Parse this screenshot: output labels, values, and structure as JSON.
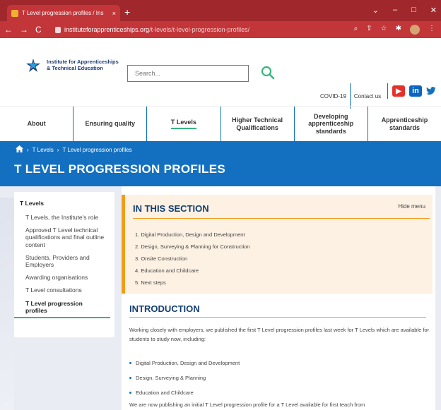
{
  "browser": {
    "tab_title": "T Level progression profiles / Ins",
    "tab_close": "×",
    "new_tab": "+",
    "url_host": "instituteforapprenticeships.org",
    "url_path": "/t-levels/t-level-progression-profiles/",
    "window_controls": [
      "⌄",
      "–",
      "□",
      "✕"
    ]
  },
  "header": {
    "logo_line1": "Institute for Apprenticeships",
    "logo_line2": "& Technical Education",
    "search_placeholder": "Search...",
    "utility_links": [
      "COVID-19",
      "Contact us"
    ],
    "social": [
      "youtube-icon",
      "linkedin-icon",
      "twitter-icon"
    ],
    "colors": {
      "brand_blue": "#1370c0",
      "accent_orange": "#f39b1a",
      "accent_green": "#37b57f",
      "chrome_red": "#c2363a"
    }
  },
  "nav": {
    "items": [
      {
        "label": "About"
      },
      {
        "label": "Ensuring quality"
      },
      {
        "label": "T Levels",
        "active": true
      },
      {
        "label": "Higher Technical Qualifications"
      },
      {
        "label": "Developing apprenticeship standards"
      },
      {
        "label": "Apprenticeship standards"
      }
    ]
  },
  "banner": {
    "breadcrumb": [
      "T Levels",
      "T Level progression profiles"
    ],
    "title": "T LEVEL PROGRESSION PROFILES"
  },
  "sidebar": {
    "title": "T Levels",
    "items": [
      "T Levels, the Institute's role",
      "Approved T Level technical qualifications and final outline content",
      "Students, Providers and Employers",
      "Awarding organisations",
      "T Level consultations",
      "T Level progression profiles"
    ]
  },
  "section": {
    "heading": "IN THIS SECTION",
    "hide_menu": "Hide menu",
    "items": [
      "1. Digital Production, Design and Development",
      "2. Design, Surveying & Planning for Construction",
      "3. Onsite Construction",
      "4. Education and Childcare",
      "5. Next steps"
    ]
  },
  "intro": {
    "heading": "INTRODUCTION",
    "para1": "Working closely with employers, we published the first T Level progression profiles last week for T Levels which are available for students to study now, including:",
    "bullets": [
      "Digital Production, Design and Development",
      "Design, Surveying & Planning",
      "Education and Childcare"
    ],
    "para2": "We are now publishing an initial T Level progression profile for a T Level available for first teach from"
  }
}
